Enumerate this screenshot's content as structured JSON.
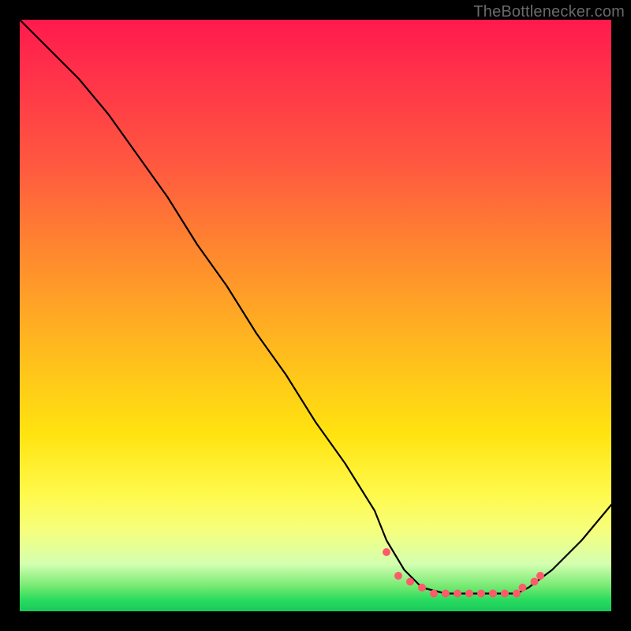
{
  "watermark": "TheBottlenecker.com",
  "chart_data": {
    "type": "line",
    "title": "",
    "xlabel": "",
    "ylabel": "",
    "xlim": [
      0,
      100
    ],
    "ylim": [
      0,
      100
    ],
    "grid": false,
    "legend": false,
    "series": [
      {
        "name": "curve",
        "x": [
          0,
          5,
          10,
          15,
          20,
          25,
          30,
          35,
          40,
          45,
          50,
          55,
          60,
          62,
          65,
          68,
          72,
          76,
          80,
          84,
          86,
          90,
          95,
          100
        ],
        "y": [
          100,
          95,
          90,
          84,
          77,
          70,
          62,
          55,
          47,
          40,
          32,
          25,
          17,
          12,
          7,
          4,
          3,
          3,
          3,
          3,
          4,
          7,
          12,
          18
        ]
      }
    ],
    "highlight_points": {
      "name": "highlight",
      "marker": "circle",
      "color": "#ff5a6a",
      "x": [
        62,
        64,
        66,
        68,
        70,
        72,
        74,
        76,
        78,
        80,
        82,
        84,
        85,
        87,
        88
      ],
      "y": [
        10,
        6,
        5,
        4,
        3,
        3,
        3,
        3,
        3,
        3,
        3,
        3,
        4,
        5,
        6
      ]
    }
  }
}
